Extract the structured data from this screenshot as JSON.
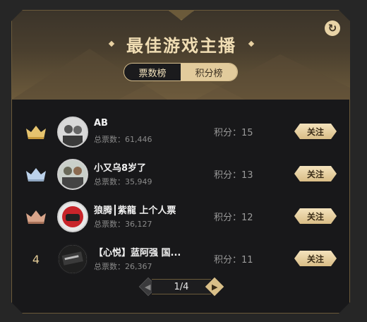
{
  "header": {
    "title": "最佳游戏主播"
  },
  "tabs": [
    {
      "label": "票数榜",
      "active": true
    },
    {
      "label": "积分榜",
      "active": false
    }
  ],
  "streamers": [
    {
      "rank": 1,
      "rank_icon": "gold-crown-icon",
      "name": "AB",
      "votes_label": "总票数：61,446",
      "score_label": "积分：15",
      "follow_label": "关注"
    },
    {
      "rank": 2,
      "rank_icon": "silver-crown-icon",
      "name": "小又乌8岁了",
      "votes_label": "总票数：35,949",
      "score_label": "积分：13",
      "follow_label": "关注"
    },
    {
      "rank": 3,
      "rank_icon": "bronze-crown-icon",
      "name": "狼腾┃紫龍 上个人票",
      "votes_label": "总票数：36,127",
      "score_label": "积分：12",
      "follow_label": "关注"
    },
    {
      "rank": 4,
      "rank_label": "4",
      "name": "【心悦】蓝阿强 国...",
      "votes_label": "总票数：26,367",
      "score_label": "积分：11",
      "follow_label": "关注"
    }
  ],
  "pagination": {
    "label": "1/4"
  },
  "colors": {
    "gold": "#e4cc98",
    "silver": "#bcd2ea",
    "bronze": "#d8a48a",
    "panel": "#18181a"
  }
}
